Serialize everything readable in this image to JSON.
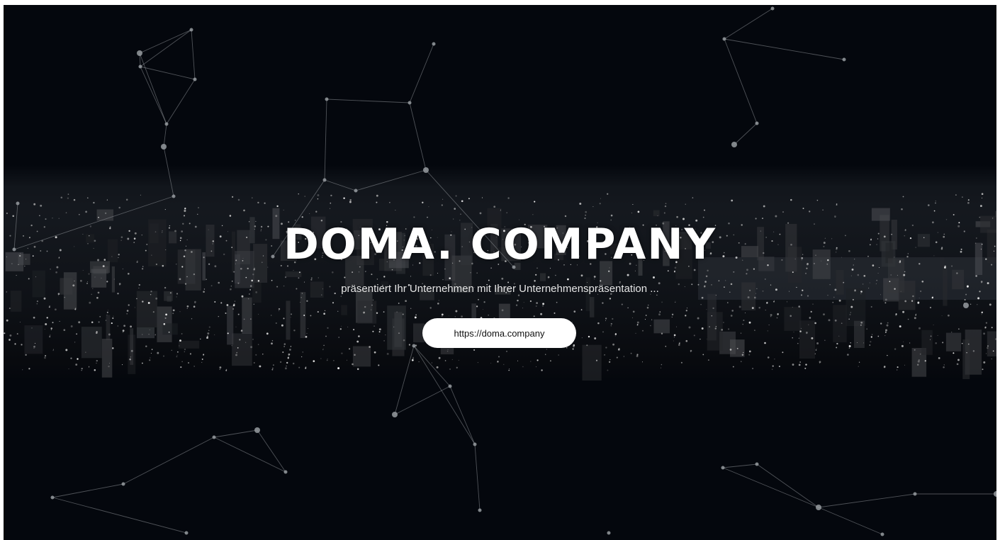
{
  "hero": {
    "title": "DOMA. COMPANY",
    "subtitle": "präsentiert Ihr Unternehmen mit Ihrer Unternehmenspräsentation ...",
    "cta_label": "https://doma.company"
  },
  "colors": {
    "background": "#04070d",
    "button_bg": "#ffffff",
    "button_text": "#111111",
    "title": "#ffffff"
  },
  "decor": {
    "background_image": "night-city-skyline-icon",
    "network": "particle-network-icon"
  }
}
